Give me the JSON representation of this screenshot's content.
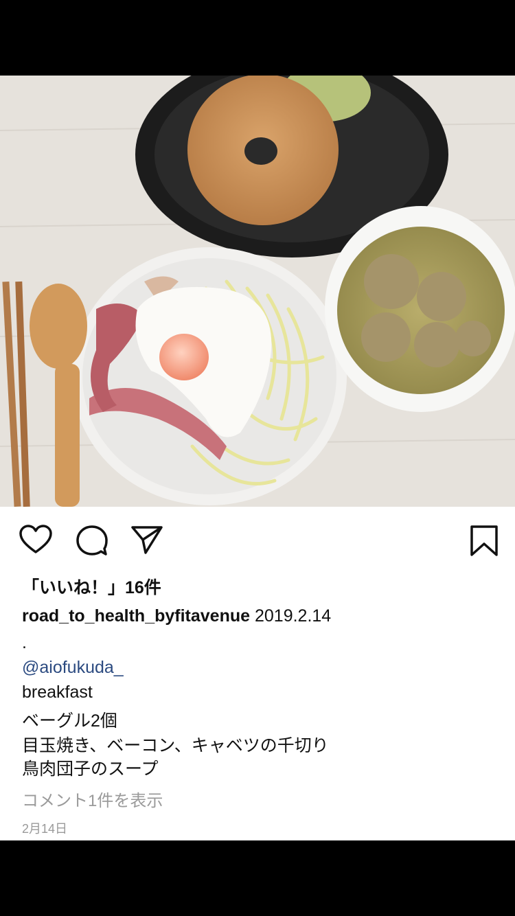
{
  "post": {
    "photo_alt": "",
    "likes_label": "「いいね！」16件",
    "username": "road_to_health_byfitavenue",
    "caption_date": "2019.2.14",
    "caption_lines": [
      ".",
      "@aiofukuda_",
      "breakfast",
      "ベーグル2個",
      "目玉焼き、ベーコン、キャベツの千切り",
      "鳥肉団子のスープ"
    ],
    "view_comments": "コメント1件を表示",
    "post_date": "2月14日"
  },
  "actions": {
    "like_icon": "heart-icon",
    "comment_icon": "comment-icon",
    "share_icon": "paper-plane-icon",
    "save_icon": "bookmark-icon"
  },
  "colors": {
    "mention": "#2b4a80",
    "muted": "#9a9a9a",
    "text": "#111111"
  }
}
